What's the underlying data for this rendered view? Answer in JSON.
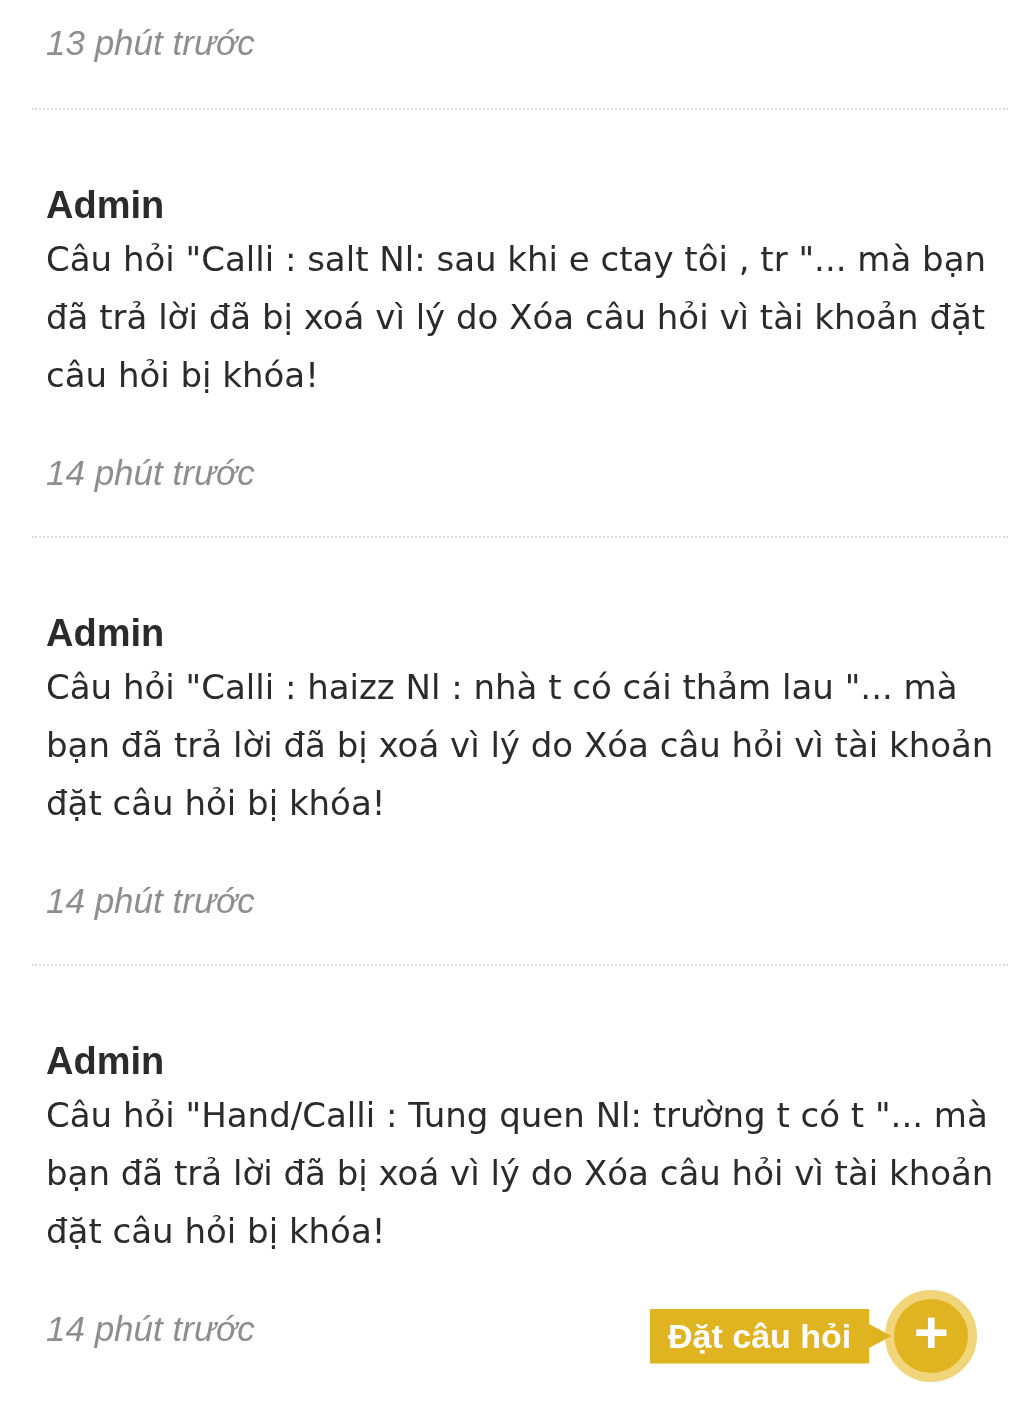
{
  "previous_notification": {
    "time": "13 phút trước"
  },
  "notifications": [
    {
      "author": "Admin",
      "message": "Câu hỏi \"Calli : salt Nl: sau khi e ctay tôi , tr \"... mà bạn đã trả lời đã bị xoá vì lý do Xóa câu hỏi vì tài khoản đặt câu hỏi bị khóa!",
      "time": "14 phút trước"
    },
    {
      "author": "Admin",
      "message": "Câu hỏi \"Calli : haizz Nl : nhà t có cái thảm lau \"... mà bạn đã trả lời đã bị xoá vì lý do Xóa câu hỏi vì tài khoản đặt câu hỏi bị khóa!",
      "time": "14 phút trước"
    },
    {
      "author": "Admin",
      "message": "Câu hỏi \"Hand/Calli : Tung quen Nl: trường t có t \"... mà bạn đã trả lời đã bị xoá vì lý do Xóa câu hỏi vì tài khoản đặt câu hỏi bị khóa!",
      "time": "14 phút trước"
    }
  ],
  "ask_button": {
    "label": "Đặt câu hỏi",
    "icon": "+"
  }
}
